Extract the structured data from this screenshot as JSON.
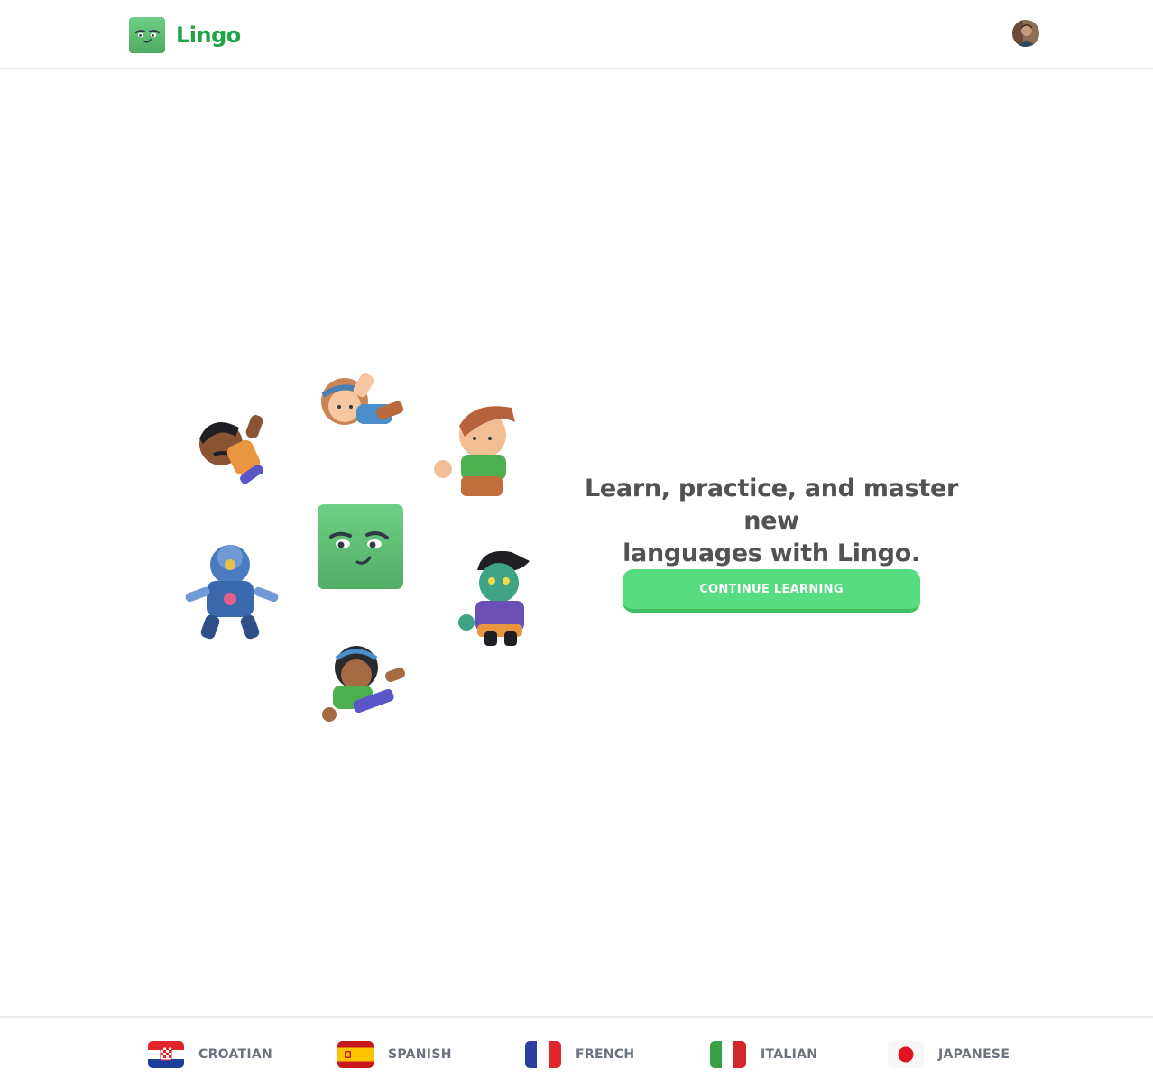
{
  "header": {
    "brand_name": "Lingo",
    "brand_icon": "lingo-mascot-icon",
    "avatar_icon": "user-avatar"
  },
  "hero": {
    "tagline_line1": "Learn, practice, and master new",
    "tagline_line2": "languages with Lingo.",
    "cta_label": "CONTINUE LEARNING",
    "illustration_icons": [
      "mascot-icon",
      "character-icon",
      "robot-icon"
    ]
  },
  "footer": {
    "languages": [
      {
        "label": "CROATIAN",
        "flag": "croatia-flag-icon"
      },
      {
        "label": "SPANISH",
        "flag": "spain-flag-icon"
      },
      {
        "label": "FRENCH",
        "flag": "france-flag-icon"
      },
      {
        "label": "ITALIAN",
        "flag": "italy-flag-icon"
      },
      {
        "label": "JAPANESE",
        "flag": "japan-flag-icon"
      }
    ]
  },
  "colors": {
    "brand": "#22a447",
    "cta": "#58dc80",
    "cta_shadow": "#3fbf64",
    "text": "#525252"
  }
}
